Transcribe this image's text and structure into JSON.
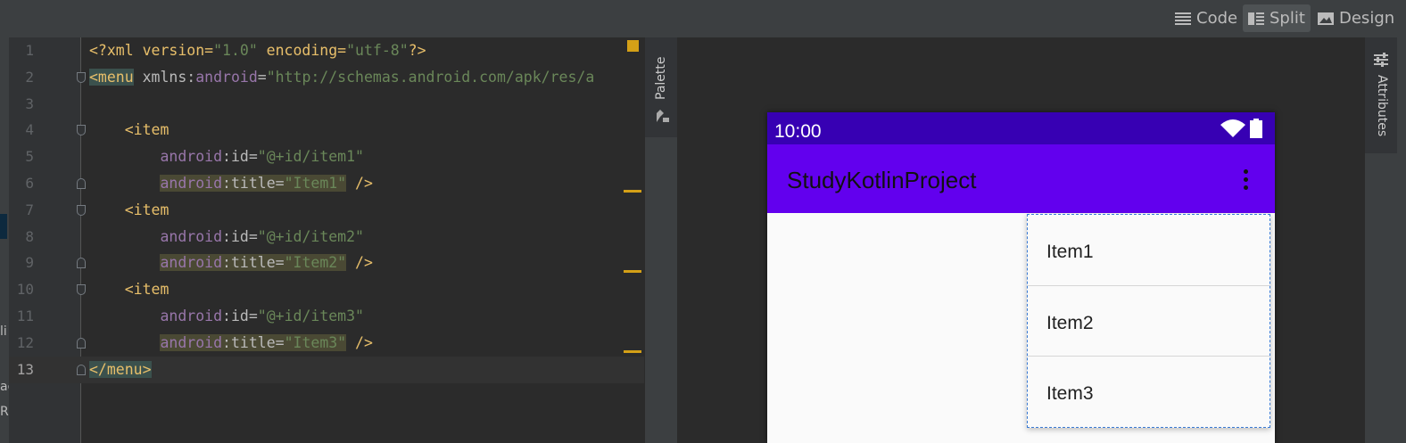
{
  "toolbar": {
    "modes": [
      {
        "label": "Code",
        "icon": "code-lines-icon"
      },
      {
        "label": "Split",
        "icon": "split-view-icon"
      },
      {
        "label": "Design",
        "icon": "image-icon"
      }
    ],
    "active_mode": "Split"
  },
  "left_strip": {
    "fragments": [
      "li",
      "ac",
      "R"
    ]
  },
  "editor": {
    "current_line": 13,
    "lines": [
      {
        "num": "1",
        "tokens": [
          {
            "t": "<?xml version=",
            "c": "tag"
          },
          {
            "t": "\"1.0\"",
            "c": "val"
          },
          {
            "t": " encoding=",
            "c": "tag"
          },
          {
            "t": "\"utf-8\"",
            "c": "val"
          },
          {
            "t": "?>",
            "c": "tag"
          }
        ]
      },
      {
        "num": "2",
        "tokens": [
          {
            "t": "<menu",
            "c": "tag",
            "h": "tag"
          },
          {
            "t": " xmlns:",
            "c": "attr"
          },
          {
            "t": "android",
            "c": "attrns"
          },
          {
            "t": "=",
            "c": "attr"
          },
          {
            "t": "\"http://schemas.android.com/apk/res/a",
            "c": "val"
          }
        ]
      },
      {
        "num": "3",
        "tokens": []
      },
      {
        "num": "4",
        "tokens": [
          {
            "t": "    <item",
            "c": "tag"
          }
        ]
      },
      {
        "num": "5",
        "tokens": [
          {
            "t": "        ",
            "c": "plain"
          },
          {
            "t": "android",
            "c": "attrns"
          },
          {
            "t": ":id=",
            "c": "attr"
          },
          {
            "t": "\"@+id/item1\"",
            "c": "val"
          }
        ]
      },
      {
        "num": "6",
        "tokens": [
          {
            "t": "        ",
            "c": "plain"
          },
          {
            "t": "android",
            "c": "attrns",
            "h": "olive"
          },
          {
            "t": ":title=",
            "c": "attr",
            "h": "olive"
          },
          {
            "t": "\"Item1\"",
            "c": "val",
            "h": "olive"
          },
          {
            "t": " />",
            "c": "tag"
          }
        ]
      },
      {
        "num": "7",
        "tokens": [
          {
            "t": "    <item",
            "c": "tag"
          }
        ]
      },
      {
        "num": "8",
        "tokens": [
          {
            "t": "        ",
            "c": "plain"
          },
          {
            "t": "android",
            "c": "attrns"
          },
          {
            "t": ":id=",
            "c": "attr"
          },
          {
            "t": "\"@+id/item2\"",
            "c": "val"
          }
        ]
      },
      {
        "num": "9",
        "tokens": [
          {
            "t": "        ",
            "c": "plain"
          },
          {
            "t": "android",
            "c": "attrns",
            "h": "olive"
          },
          {
            "t": ":title=",
            "c": "attr",
            "h": "olive"
          },
          {
            "t": "\"Item2\"",
            "c": "val",
            "h": "olive"
          },
          {
            "t": " />",
            "c": "tag"
          }
        ]
      },
      {
        "num": "10",
        "tokens": [
          {
            "t": "    <item",
            "c": "tag"
          }
        ]
      },
      {
        "num": "11",
        "tokens": [
          {
            "t": "        ",
            "c": "plain"
          },
          {
            "t": "android",
            "c": "attrns"
          },
          {
            "t": ":id=",
            "c": "attr"
          },
          {
            "t": "\"@+id/item3\"",
            "c": "val"
          }
        ]
      },
      {
        "num": "12",
        "tokens": [
          {
            "t": "        ",
            "c": "plain"
          },
          {
            "t": "android",
            "c": "attrns",
            "h": "olive"
          },
          {
            "t": ":title=",
            "c": "attr",
            "h": "olive"
          },
          {
            "t": "\"Item3\"",
            "c": "val",
            "h": "olive"
          },
          {
            "t": " />",
            "c": "tag"
          }
        ]
      },
      {
        "num": "13",
        "tokens": [
          {
            "t": "</menu>",
            "c": "tag",
            "h": "tag"
          }
        ]
      }
    ]
  },
  "side_tabs": {
    "palette": "Palette",
    "attributes": "Attributes"
  },
  "preview": {
    "status_time": "10:00",
    "app_title": "StudyKotlinProject",
    "menu_items": [
      "Item1",
      "Item2",
      "Item3"
    ],
    "colors": {
      "status_bar": "#3700b3",
      "app_bar": "#6200ee",
      "selection": "#3a7bd5"
    }
  }
}
